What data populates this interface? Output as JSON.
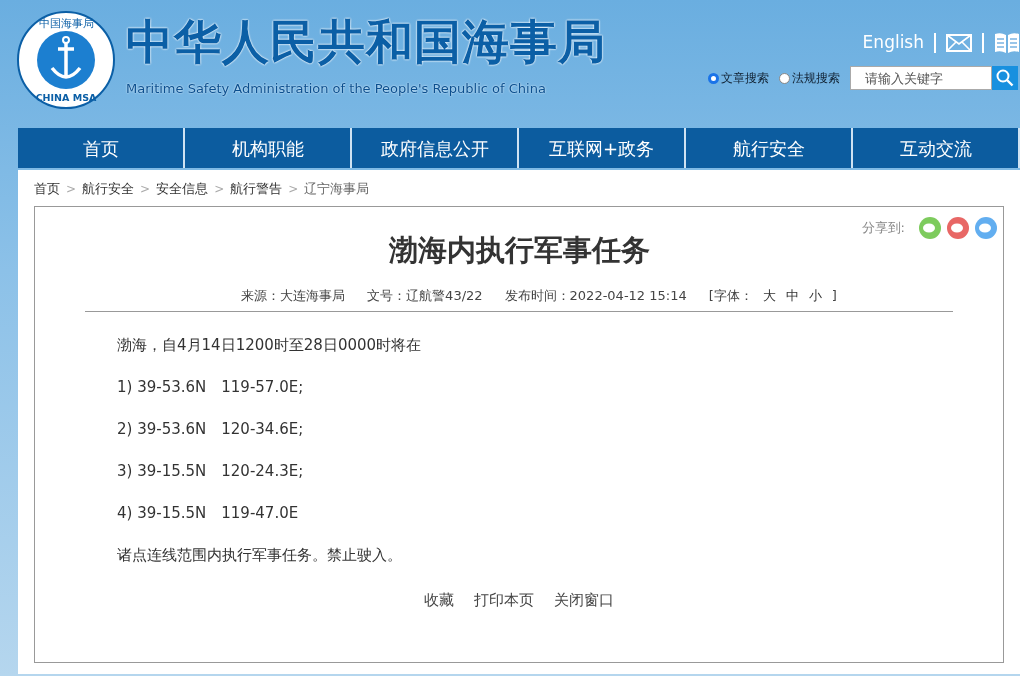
{
  "header": {
    "logo": {
      "top_text": "中国海事局",
      "bottom_text": "CHINA MSA"
    },
    "title": "中华人民共和国海事局",
    "subtitle": "Maritime Safety Administration of the People's Republic of China",
    "links": [
      "English"
    ],
    "search_scopes": [
      {
        "label": "文章搜索",
        "selected": true
      },
      {
        "label": "法规搜索",
        "selected": false
      }
    ],
    "search": {
      "placeholder": "请输入关键字"
    }
  },
  "nav": [
    {
      "label": "首页"
    },
    {
      "label": "机构职能"
    },
    {
      "label": "政府信息公开"
    },
    {
      "label": "互联网+政务"
    },
    {
      "label": "航行安全"
    },
    {
      "label": "互动交流"
    }
  ],
  "breadcrumb": [
    {
      "label": "首页"
    },
    {
      "sep": ">",
      "label": "航行安全"
    },
    {
      "sep": ">",
      "label": "安全信息"
    },
    {
      "sep": ">",
      "label": "航行警告"
    },
    {
      "sep": ">",
      "label": "辽宁海事局"
    }
  ],
  "article": {
    "share_label": "分享到:",
    "title": "渤海内执行军事任务",
    "meta": [
      "来源：大连海事局",
      "文号：辽航警43/22",
      "发布时间：2022-04-12 15:14"
    ],
    "font_size": {
      "label": "[字体：",
      "options": [
        "大",
        "中",
        "小"
      ],
      "end": "]"
    },
    "paragraphs": [
      "渤海，自4月14日1200时至28日0000时将在",
      "1) 39-53.6N　119-57.0E;",
      "2) 39-53.6N　120-34.6E;",
      "3) 39-15.5N　120-24.3E;",
      "4) 39-15.5N　119-47.0E",
      "诸点连线范围内执行军事任务。禁止驶入。"
    ],
    "actions": [
      "收藏",
      "打印本页",
      "关闭窗口"
    ]
  }
}
